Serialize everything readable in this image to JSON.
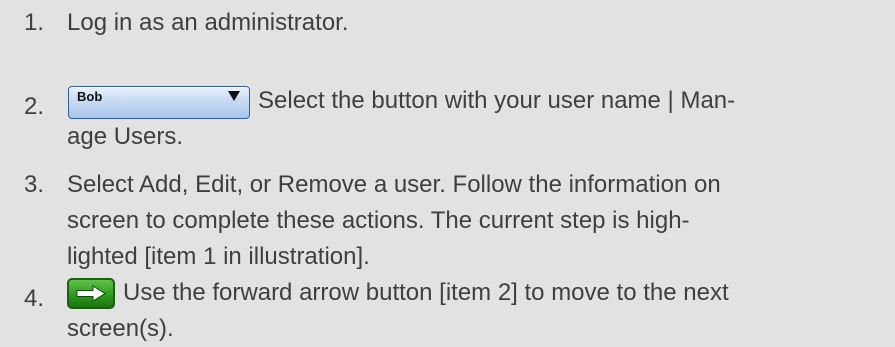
{
  "steps": [
    {
      "number": "1.",
      "lines": [
        "Log in as an administrator."
      ]
    },
    {
      "number": "2.",
      "button_label": "Bob",
      "lines": [
        "Select the button with your user name | Man-",
        "age Users."
      ]
    },
    {
      "number": "3.",
      "lines": [
        "Select Add, Edit, or Remove a user. Follow the information on",
        "screen to complete these actions. The current step is high-",
        "lighted [item 1 in illustration]."
      ]
    },
    {
      "number": "4.",
      "button_icon": "forward-arrow-icon",
      "lines": [
        "Use the forward arrow button [item 2] to move to the next",
        "screen(s)."
      ]
    }
  ],
  "colors": {
    "background": "#e2e2e2",
    "text": "#3f3f3f",
    "user_button": "#b5cdee",
    "forward_button": "#2e9a1e"
  }
}
